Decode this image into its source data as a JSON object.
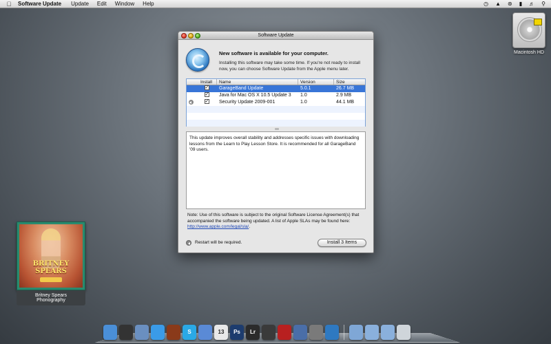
{
  "menubar": {
    "app_name": "Software Update",
    "menus": [
      "Update",
      "Edit",
      "Window",
      "Help"
    ]
  },
  "desktop": {
    "hd_label": "Macintosh HD",
    "album": {
      "cover_title": "BRITNEY SPEARS",
      "caption_line1": "Britney Spears",
      "caption_line2": "Phonography"
    }
  },
  "window": {
    "title": "Software Update",
    "headline": "New software is available for your computer.",
    "subtext": "Installing this software may take some time. If you're not ready to install now, you can choose Software Update from the Apple menu later.",
    "table": {
      "headers": {
        "install": "Install",
        "name": "Name",
        "version": "Version",
        "size": "Size"
      },
      "rows": [
        {
          "name": "GarageBand Update",
          "version": "5.0.1",
          "size": "26.7 MB",
          "checked": true,
          "selected": true
        },
        {
          "name": "Java for Mac OS X 10.5 Update 3",
          "version": "1.0",
          "size": "2.9 MB",
          "checked": true,
          "selected": false
        },
        {
          "name": "Security Update 2009-001",
          "version": "1.0",
          "size": "44.1 MB",
          "checked": true,
          "selected": false
        }
      ]
    },
    "description": "This update improves overall stability and addresses specific issues with downloading lessons from the Learn to Play Lesson Store. It is recommended for all GarageBand '09 users.",
    "license_text": "Note: Use of this software is subject to the original Software License Agreement(s) that accompanied the software being updated. A list of Apple SLAs may be found here:",
    "license_link": "http://www.apple.com/legal/sla/",
    "license_end": ".",
    "restart_text": "Restart will be required.",
    "install_button": "Install 3 Items"
  },
  "dock": {
    "icons": [
      {
        "name": "finder-icon",
        "color": "#4a8fd8",
        "glyph": ""
      },
      {
        "name": "dashboard-icon",
        "color": "#333333",
        "glyph": ""
      },
      {
        "name": "preview-icon",
        "color": "#6a8fc0",
        "glyph": ""
      },
      {
        "name": "safari-icon",
        "color": "#3a9be8",
        "glyph": ""
      },
      {
        "name": "domo-icon",
        "color": "#8a3a1a",
        "glyph": ""
      },
      {
        "name": "skype-icon",
        "color": "#2aa9e6",
        "glyph": "S"
      },
      {
        "name": "ichat-icon",
        "color": "#5a8ad6",
        "glyph": ""
      },
      {
        "name": "ical-icon",
        "color": "#e8e8e8",
        "glyph": "13"
      },
      {
        "name": "photoshop-icon",
        "color": "#1d3c6e",
        "glyph": "Ps"
      },
      {
        "name": "lightroom-icon",
        "color": "#2b2b2b",
        "glyph": "Lr"
      },
      {
        "name": "aperture-icon",
        "color": "#3a3a3a",
        "glyph": ""
      },
      {
        "name": "photobooth-icon",
        "color": "#b82020",
        "glyph": ""
      },
      {
        "name": "xcode-icon",
        "color": "#4a6ea8",
        "glyph": ""
      },
      {
        "name": "system-preferences-icon",
        "color": "#7a7a7a",
        "glyph": ""
      },
      {
        "name": "software-update-icon",
        "color": "#2e79c1",
        "glyph": ""
      },
      {
        "name": "applications-folder-icon",
        "color": "#7fa7d6",
        "glyph": ""
      },
      {
        "name": "documents-folder-icon",
        "color": "#8ab0dc",
        "glyph": ""
      },
      {
        "name": "downloads-folder-icon",
        "color": "#8ab0dc",
        "glyph": ""
      },
      {
        "name": "trash-icon",
        "color": "#cfd5da",
        "glyph": ""
      }
    ]
  }
}
